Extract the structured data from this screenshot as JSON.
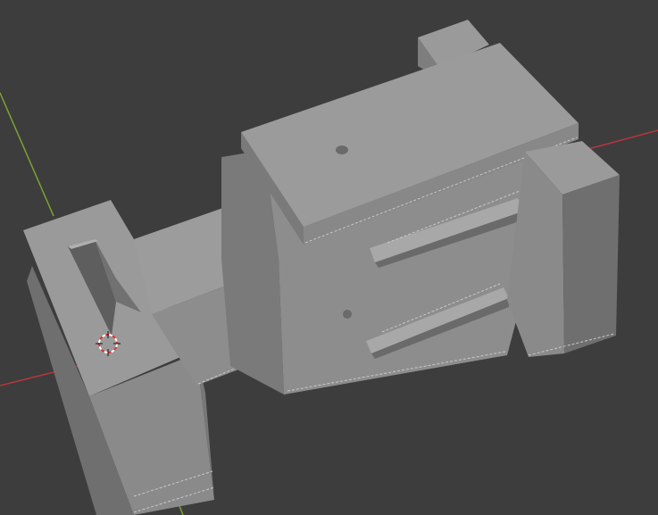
{
  "viewport": {
    "background": "#3d3d3d",
    "colors": {
      "x_axis": "#b8363c",
      "y_axis": "#7aa435",
      "top_face": "#9a9a9a",
      "side_face": "#888888",
      "dark_face": "#6f6f6f",
      "inner_face": "#5e5e5e",
      "edge": "#c9c9c9",
      "cursor_ring_red": "#e03030",
      "cursor_ring_white": "#ffffff"
    },
    "icons": {
      "cursor": "3d-cursor-icon"
    }
  }
}
